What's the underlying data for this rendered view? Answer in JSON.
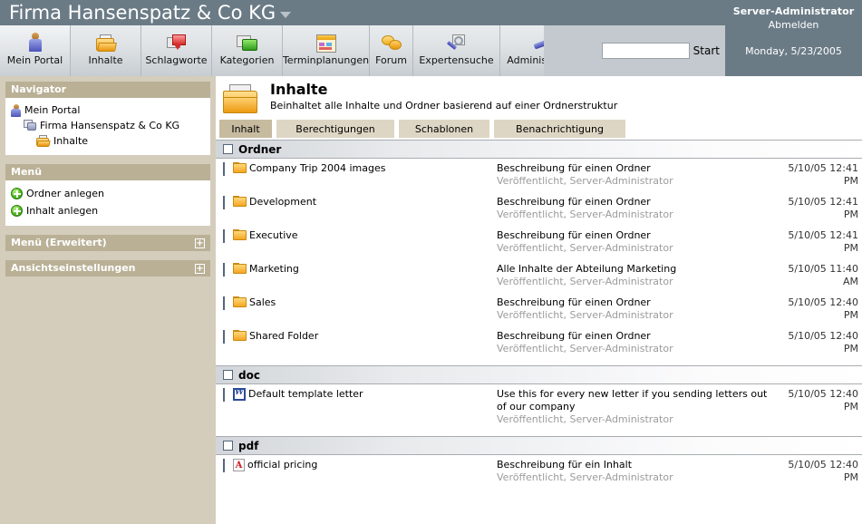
{
  "titlebar": {
    "org_name": "Firma Hansenspatz & Co KG",
    "caret_icon": "chevron-down-icon"
  },
  "user": {
    "name": "Server-Administrator",
    "logout_label": "Abmelden",
    "date": "Monday, 5/23/2005"
  },
  "nav": {
    "tabs": [
      {
        "label": "Mein Portal",
        "icon": "person-icon",
        "selected": true
      },
      {
        "label": "Inhalte",
        "icon": "open-folder-icon",
        "selected": false
      },
      {
        "label": "Schlagworte",
        "icon": "tag-bubble-icon",
        "selected": false
      },
      {
        "label": "Kategorien",
        "icon": "green-folders-icon",
        "selected": false
      },
      {
        "label": "Terminplanungen",
        "icon": "calendar-icon",
        "selected": false
      },
      {
        "label": "Forum",
        "icon": "speech-bubbles-icon",
        "selected": false
      },
      {
        "label": "Expertensuche",
        "icon": "magnifier-icon",
        "selected": false
      },
      {
        "label": "Administration",
        "icon": "wrench-icon",
        "selected": false
      }
    ]
  },
  "search": {
    "value": "",
    "placeholder": "",
    "start_label": "Start"
  },
  "sidebar": {
    "navigator": {
      "title": "Navigator",
      "items": [
        {
          "label": "Mein Portal",
          "icon": "person-icon",
          "level": 1
        },
        {
          "label": "Firma Hansenspatz & Co KG",
          "icon": "portal-icon",
          "level": 2
        },
        {
          "label": "Inhalte",
          "icon": "open-folder-icon",
          "level": 3
        }
      ]
    },
    "menu": {
      "title": "Menü",
      "items": [
        {
          "label": "Ordner anlegen",
          "icon": "plus-circle-icon"
        },
        {
          "label": "Inhalt anlegen",
          "icon": "plus-circle-icon"
        }
      ]
    },
    "menu_advanced": {
      "title": "Menü (Erweitert)",
      "expander": "plus-box-icon"
    },
    "view_settings": {
      "title": "Ansichtseinstellungen",
      "expander": "plus-box-icon"
    }
  },
  "page": {
    "icon": "folder-large-icon",
    "title": "Inhalte",
    "subtitle": "Beinhaltet alle Inhalte und Ordner basierend auf einer Ordnerstruktur",
    "tabs": [
      {
        "label": "Inhalt",
        "active": true
      },
      {
        "label": "Berechtigungen",
        "active": false
      },
      {
        "label": "Schablonen",
        "active": false
      },
      {
        "label": "Benachrichtigung",
        "active": false
      }
    ]
  },
  "list": {
    "groups": [
      {
        "title": "Ordner",
        "rows": [
          {
            "name": "Company Trip 2004 images",
            "icon": "folder-icon",
            "description": "Beschreibung für einen Ordner",
            "status": "Veröffentlicht, Server-Administrator",
            "date": "5/10/05 12:41 PM"
          },
          {
            "name": "Development",
            "icon": "folder-icon",
            "description": "Beschreibung für einen Ordner",
            "status": "Veröffentlicht, Server-Administrator",
            "date": "5/10/05 12:41 PM"
          },
          {
            "name": "Executive",
            "icon": "folder-icon",
            "description": "Beschreibung für einen Ordner",
            "status": "Veröffentlicht, Server-Administrator",
            "date": "5/10/05 12:41 PM"
          },
          {
            "name": "Marketing",
            "icon": "folder-icon",
            "description": "Alle Inhalte der Abteilung Marketing",
            "status": "Veröffentlicht, Server-Administrator",
            "date": "5/10/05 11:40 AM"
          },
          {
            "name": "Sales",
            "icon": "folder-icon",
            "description": "Beschreibung für einen Ordner",
            "status": "Veröffentlicht, Server-Administrator",
            "date": "5/10/05 12:40 PM"
          },
          {
            "name": "Shared Folder",
            "icon": "folder-icon",
            "description": "Beschreibung für einen Ordner",
            "status": "Veröffentlicht, Server-Administrator",
            "date": "5/10/05 12:40 PM"
          }
        ]
      },
      {
        "title": "doc",
        "rows": [
          {
            "name": "Default template letter",
            "icon": "word-document-icon",
            "description": "Use this for every new letter if you sending letters out of our company",
            "status": "Veröffentlicht, Server-Administrator",
            "date": "5/10/05 12:40 PM"
          }
        ]
      },
      {
        "title": "pdf",
        "rows": [
          {
            "name": "official pricing",
            "icon": "pdf-document-icon",
            "description": "Beschreibung für ein Inhalt",
            "status": "Veröffentlicht, Server-Administrator",
            "date": "5/10/05 12:40 PM"
          }
        ]
      }
    ]
  },
  "colors": {
    "titlebar": "#6b7b86",
    "navbar": "#c3c9ce",
    "sidebar": "#d4cdbc",
    "panel_header": "#b9b096",
    "tab_inactive": "#ded6c4",
    "tab_active": "#c6bb9f",
    "muted_text": "#9b9b9b"
  }
}
